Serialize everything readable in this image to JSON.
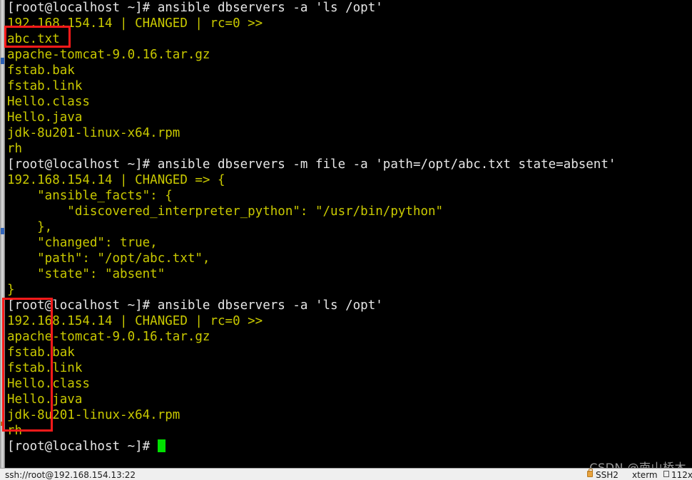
{
  "terminal": {
    "background": "#000000",
    "prompt_color": "#e6e6e6",
    "output_color": "#c9c900",
    "cursor_color": "#00e000",
    "lines": [
      {
        "text": "[root@localhost ~]# ansible dbservers -a 'ls /opt'",
        "kind": "prompt"
      },
      {
        "text": "192.168.154.14 | CHANGED | rc=0 >>",
        "kind": "output"
      },
      {
        "text": "abc.txt",
        "kind": "output"
      },
      {
        "text": "apache-tomcat-9.0.16.tar.gz",
        "kind": "output"
      },
      {
        "text": "fstab.bak",
        "kind": "output"
      },
      {
        "text": "fstab.link",
        "kind": "output"
      },
      {
        "text": "Hello.class",
        "kind": "output"
      },
      {
        "text": "Hello.java",
        "kind": "output"
      },
      {
        "text": "jdk-8u201-linux-x64.rpm",
        "kind": "output"
      },
      {
        "text": "rh",
        "kind": "output"
      },
      {
        "text": "[root@localhost ~]# ansible dbservers -m file -a 'path=/opt/abc.txt state=absent'",
        "kind": "prompt"
      },
      {
        "text": "192.168.154.14 | CHANGED => {",
        "kind": "output"
      },
      {
        "text": "    \"ansible_facts\": {",
        "kind": "output"
      },
      {
        "text": "        \"discovered_interpreter_python\": \"/usr/bin/python\"",
        "kind": "output"
      },
      {
        "text": "    },",
        "kind": "output"
      },
      {
        "text": "    \"changed\": true,",
        "kind": "output"
      },
      {
        "text": "    \"path\": \"/opt/abc.txt\",",
        "kind": "output"
      },
      {
        "text": "    \"state\": \"absent\"",
        "kind": "output"
      },
      {
        "text": "}",
        "kind": "output"
      },
      {
        "text": "[root@localhost ~]# ansible dbservers -a 'ls /opt'",
        "kind": "prompt"
      },
      {
        "text": "192.168.154.14 | CHANGED | rc=0 >>",
        "kind": "output"
      },
      {
        "text": "apache-tomcat-9.0.16.tar.gz",
        "kind": "output"
      },
      {
        "text": "fstab.bak",
        "kind": "output"
      },
      {
        "text": "fstab.link",
        "kind": "output"
      },
      {
        "text": "Hello.class",
        "kind": "output"
      },
      {
        "text": "Hello.java",
        "kind": "output"
      },
      {
        "text": "jdk-8u201-linux-x64.rpm",
        "kind": "output"
      },
      {
        "text": "rh",
        "kind": "output"
      }
    ],
    "final_prompt": "[root@localhost ~]# "
  },
  "annotations": {
    "box_color": "#ff1a1a",
    "box_1_label": "abc.txt",
    "box_2_label": "second-ls-output"
  },
  "watermark": {
    "text": "CSDN @南山桥木"
  },
  "statusbar": {
    "connection": "ssh://root@192.168.154.13:22",
    "protocol": "SSH2",
    "terminal_type": "xterm",
    "size": "112x"
  }
}
